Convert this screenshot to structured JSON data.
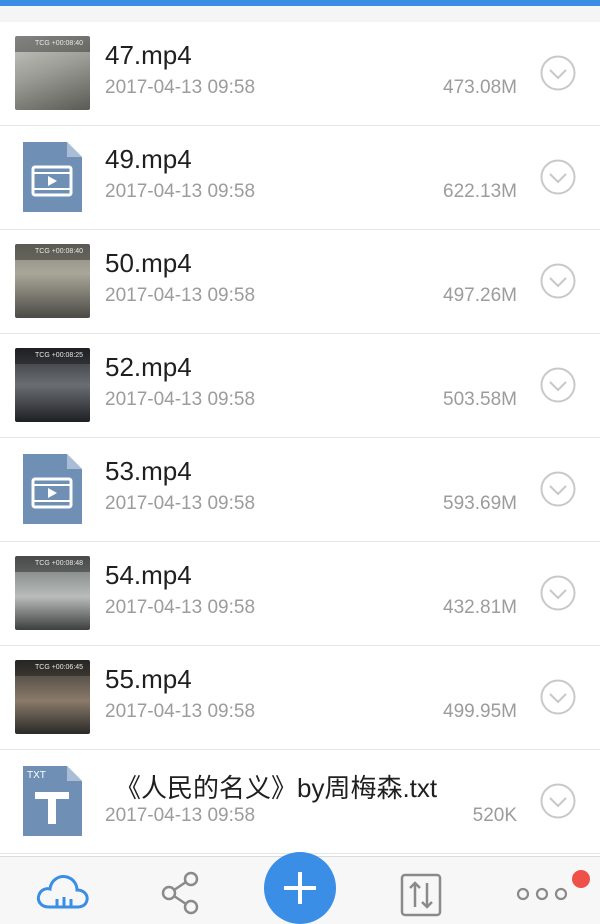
{
  "files": [
    {
      "name": "47.mp4",
      "date": "2017-04-13 09:58",
      "size": "473.08M",
      "thumb": "photo",
      "icon": "video-thumbnail",
      "osd": "TCG +00:08:40"
    },
    {
      "name": "49.mp4",
      "date": "2017-04-13 09:58",
      "size": "622.13M",
      "thumb": "generic",
      "icon": "video-file-icon"
    },
    {
      "name": "50.mp4",
      "date": "2017-04-13 09:58",
      "size": "497.26M",
      "thumb": "photo",
      "icon": "video-thumbnail",
      "osd": "TCG +00:08:40"
    },
    {
      "name": "52.mp4",
      "date": "2017-04-13 09:58",
      "size": "503.58M",
      "thumb": "photo",
      "icon": "video-thumbnail",
      "osd": "TCG +00:08:25"
    },
    {
      "name": "53.mp4",
      "date": "2017-04-13 09:58",
      "size": "593.69M",
      "thumb": "generic",
      "icon": "video-file-icon"
    },
    {
      "name": "54.mp4",
      "date": "2017-04-13 09:58",
      "size": "432.81M",
      "thumb": "photo",
      "icon": "video-thumbnail",
      "osd": "TCG +00:08:48"
    },
    {
      "name": "55.mp4",
      "date": "2017-04-13 09:58",
      "size": "499.95M",
      "thumb": "photo",
      "icon": "video-thumbnail",
      "osd": "TCG +00:06:45"
    },
    {
      "name": "《人民的名义》by周梅森.txt",
      "date": "2017-04-13 09:58",
      "size": "520K",
      "thumb": "txt",
      "icon": "txt-file-icon",
      "badge": "TXT"
    }
  ],
  "tabbar": {
    "items": [
      {
        "name": "cloud",
        "icon": "cloud-icon"
      },
      {
        "name": "share",
        "icon": "share-icon"
      },
      {
        "name": "add",
        "icon": "plus-icon"
      },
      {
        "name": "transfer",
        "icon": "transfer-icon"
      },
      {
        "name": "more",
        "icon": "more-icon"
      }
    ]
  },
  "colors": {
    "accent": "#3a8ee6",
    "file_icon": "#6f8fb5",
    "badge": "#f0504a",
    "text_primary": "#1f1f1f",
    "text_secondary": "#9c9c9c"
  }
}
